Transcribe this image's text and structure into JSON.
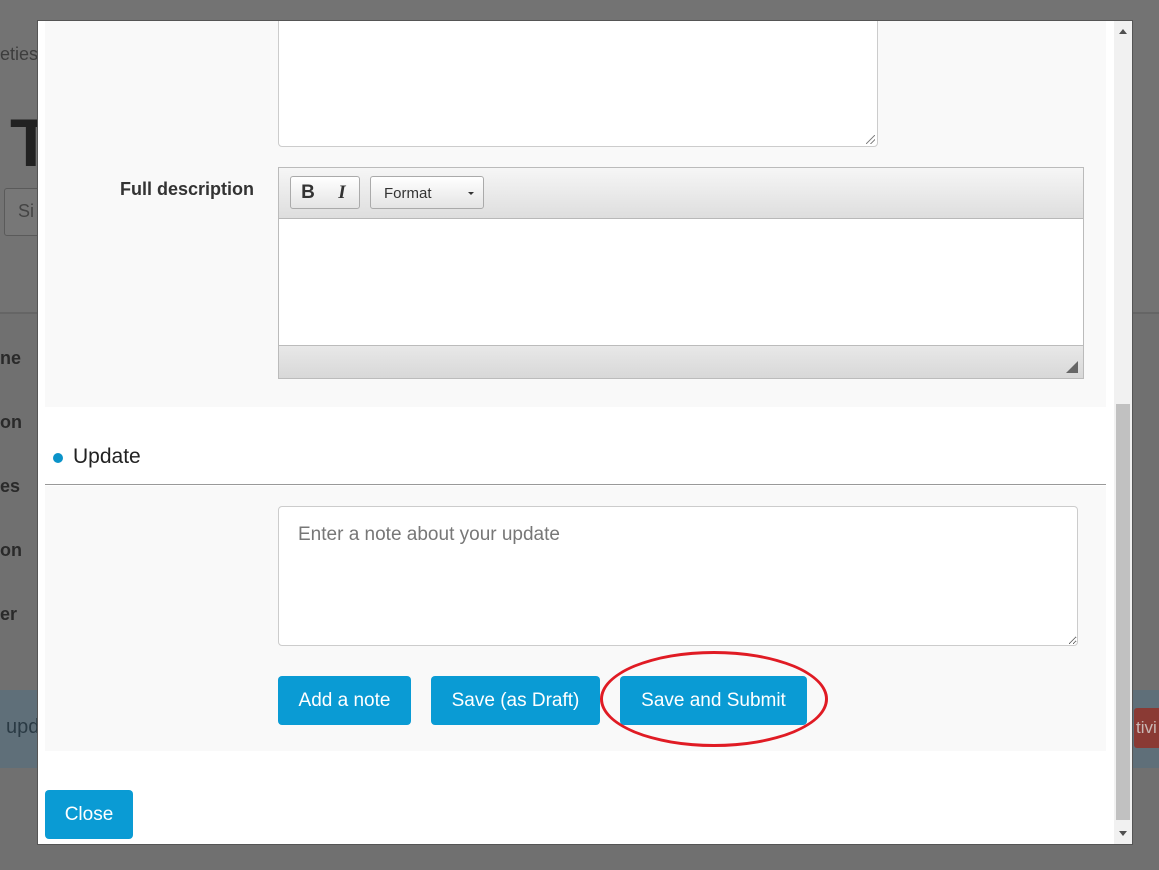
{
  "background": {
    "crumb_fragment": "eties",
    "title_fragment": "T",
    "input_fragment": "Si",
    "labels": [
      "ne",
      "on",
      "es",
      "on",
      "er"
    ],
    "update_fragment": "upd",
    "right_button_fragment": "tivi"
  },
  "modal": {
    "full_description_label": "Full description",
    "editor": {
      "bold_label": "B",
      "italic_label": "I",
      "format_label": "Format"
    },
    "update_section": {
      "title": "Update",
      "note_placeholder": "Enter a note about your update",
      "note_value": ""
    },
    "buttons": {
      "add_note": "Add a note",
      "save_draft": "Save (as Draft)",
      "save_submit": "Save and Submit",
      "close": "Close"
    },
    "colors": {
      "accent": "#0a9bd4",
      "bullet": "#0a93c9",
      "highlight": "#e01b24"
    }
  }
}
